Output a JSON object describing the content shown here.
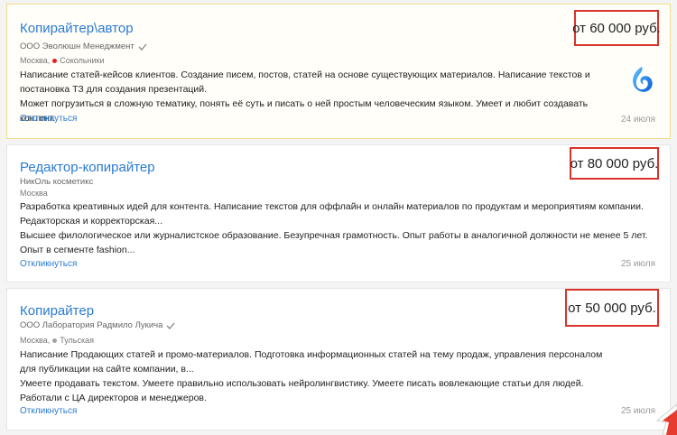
{
  "vacancies": [
    {
      "title": "Копирайтер\\автор",
      "salary": "от 60 000 руб.",
      "company": "ООО Эволюшн Менеджмент",
      "city": "Москва,",
      "metro": "Сокольники",
      "metro_color": "#e2231a",
      "description": [
        "Написание статей-кейсов клиентов. Создание писем, постов, статей на основе существующих материалов. Написание текстов и постановка ТЗ для создания презентаций.",
        "Может погрузиться в сложную тематику, понять её суть и писать о ней простым человеческим языком. Умеет и любит создавать контент."
      ],
      "apply": "Откликнуться",
      "date": "24 июля",
      "logo_icon": "blue-swirl-logo-icon"
    },
    {
      "title": "Редактор-копирайтер",
      "salary": "от 80 000 руб.",
      "company": "НикОль косметикс",
      "city": "Москва",
      "description": [
        "Разработка креативных идей для контента. Написание текстов для оффлайн и онлайн материалов по продуктам и мероприятиям компании. Редакторская и корректорская...",
        "Высшее филологическое или журналистское образование. Безупречная грамотность. Опыт работы в аналогичной должности не менее 5 лет. Опыт в сегменте fashion..."
      ],
      "apply": "Откликнуться",
      "date": "25 июля"
    },
    {
      "title": "Копирайтер",
      "salary": "от 50 000 руб.",
      "company": "ООО Лаборатория Радмило Лукича",
      "city": "Москва,",
      "metro": "Тульская",
      "metro_color": "#a1a2a3",
      "description": [
        "Написание Продающих статей и промо-материалов. Подготовка информационных статей на тему продаж, управления персоналом для публикации на сайте компании, в...",
        "Умеете продавать текстом. Умеете правильно использовать нейролингвистику. Умеете писать вовлекающие статьи для людей. Работали с ЦА директоров и менеджеров."
      ],
      "apply": "Откликнуться",
      "date": "25 июля"
    }
  ],
  "colors": {
    "link": "#2b7bd2",
    "highlight_border": "#d9332b"
  }
}
